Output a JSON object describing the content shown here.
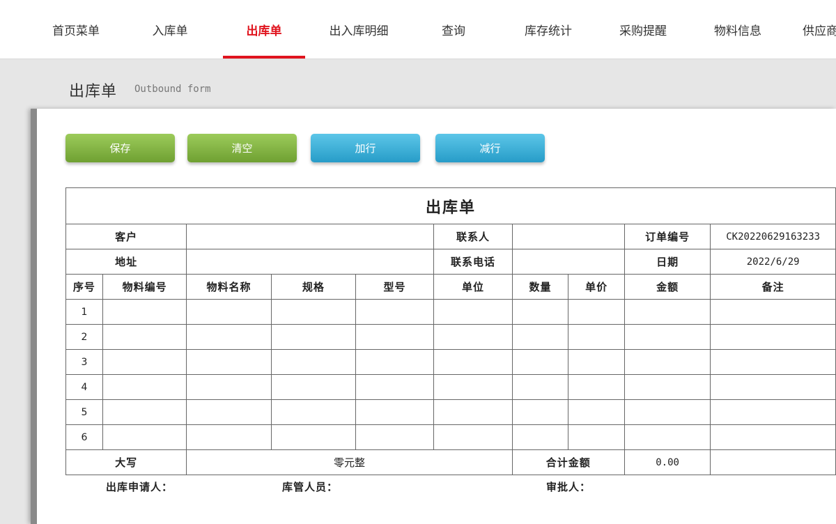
{
  "nav": {
    "items": [
      {
        "label": "首页菜单"
      },
      {
        "label": "入库单"
      },
      {
        "label": "出库单"
      },
      {
        "label": "出入库明细"
      },
      {
        "label": "查询"
      },
      {
        "label": "库存统计"
      },
      {
        "label": "采购提醒"
      },
      {
        "label": "物料信息"
      },
      {
        "label": "供应商"
      }
    ],
    "active_index": 2
  },
  "header": {
    "title": "出库单",
    "subtitle": "Outbound form"
  },
  "toolbar": {
    "save_label": "保存",
    "clear_label": "清空",
    "add_row_label": "加行",
    "remove_row_label": "减行"
  },
  "form": {
    "title": "出库单",
    "customer_label": "客户",
    "customer_value": "",
    "contact_label": "联系人",
    "contact_value": "",
    "order_no_label": "订单编号",
    "order_no_value": "CK20220629163233",
    "address_label": "地址",
    "address_value": "",
    "phone_label": "联系电话",
    "phone_value": "",
    "date_label": "日期",
    "date_value": "2022/6/29",
    "columns": {
      "seq": "序号",
      "material_code": "物料编号",
      "material_name": "物料名称",
      "spec": "规格",
      "model": "型号",
      "unit": "单位",
      "qty": "数量",
      "price": "单价",
      "amount": "金额",
      "remark": "备注"
    },
    "rows": [
      {
        "seq": "1"
      },
      {
        "seq": "2"
      },
      {
        "seq": "3"
      },
      {
        "seq": "4"
      },
      {
        "seq": "5"
      },
      {
        "seq": "6"
      }
    ],
    "uppercase_label": "大写",
    "uppercase_value": "零元整",
    "total_label": "合计金额",
    "total_value": "0.00"
  },
  "signatures": {
    "applicant_label": "出库申请人：",
    "keeper_label": "库管人员：",
    "approver_label": "审批人："
  }
}
